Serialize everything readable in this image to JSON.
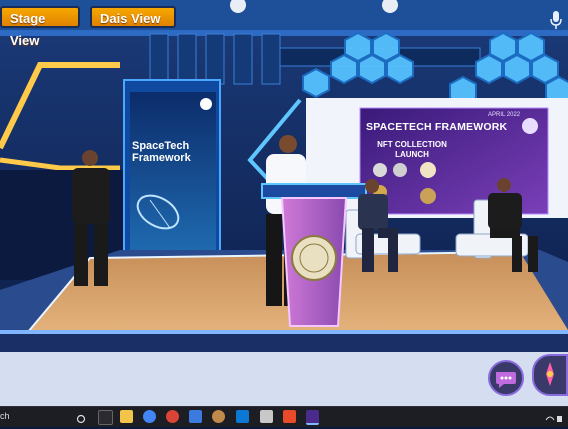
{
  "toolbar": {
    "stage_view_label": "Stage View",
    "dais_view_label": "Dais View"
  },
  "banner": {
    "title_line1": "SpaceTech",
    "title_line2": "Framework"
  },
  "screen": {
    "date": "APRIL 2022",
    "title": "SPACETECH FRAMEWORK",
    "nft_heading": "NFT COLLECTION LAUNCH"
  },
  "taskbar": {
    "search_fragment": "ch"
  },
  "icons": {
    "mic": "microphone-icon",
    "chat": "chat-icon",
    "reaction": "reaction-icon",
    "search": "search-icon"
  },
  "colors": {
    "accent": "#f39c00",
    "hex_panel": "#4fb6ff",
    "floor": "#d9a066",
    "screen_purple": "#5a2a8f"
  }
}
